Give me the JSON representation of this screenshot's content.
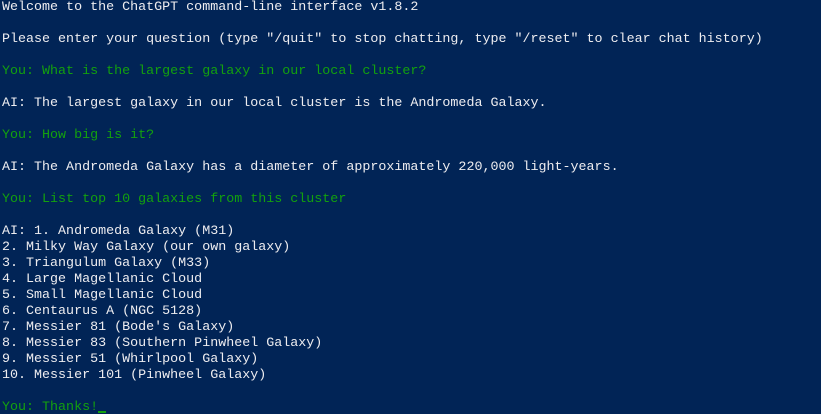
{
  "terminal": {
    "welcome": "Welcome to the ChatGPT command-line interface v1.8.2",
    "instructions": "Please enter your question (type \"/quit\" to stop chatting, type \"/reset\" to clear chat history)"
  },
  "conversation": [
    {
      "role": "user",
      "text": "You: What is the largest galaxy in our local cluster?"
    },
    {
      "role": "ai",
      "text": "AI: The largest galaxy in our local cluster is the Andromeda Galaxy."
    },
    {
      "role": "user",
      "text": "You: How big is it?"
    },
    {
      "role": "ai",
      "text": "AI: The Andromeda Galaxy has a diameter of approximately 220,000 light-years."
    },
    {
      "role": "user",
      "text": "You: List top 10 galaxies from this cluster"
    }
  ],
  "galaxy_list": [
    "AI: 1. Andromeda Galaxy (M31)",
    "2. Milky Way Galaxy (our own galaxy)",
    "3. Triangulum Galaxy (M33)",
    "4. Large Magellanic Cloud",
    "5. Small Magellanic Cloud",
    "6. Centaurus A (NGC 5128)",
    "7. Messier 81 (Bode's Galaxy)",
    "8. Messier 83 (Southern Pinwheel Galaxy)",
    "9. Messier 51 (Whirlpool Galaxy)",
    "10. Messier 101 (Pinwheel Galaxy)"
  ],
  "prompt": {
    "text": "You: Thanks!"
  },
  "colors": {
    "background": "#012456",
    "user_text": "#13a10e",
    "ai_text": "#eeedf0"
  }
}
